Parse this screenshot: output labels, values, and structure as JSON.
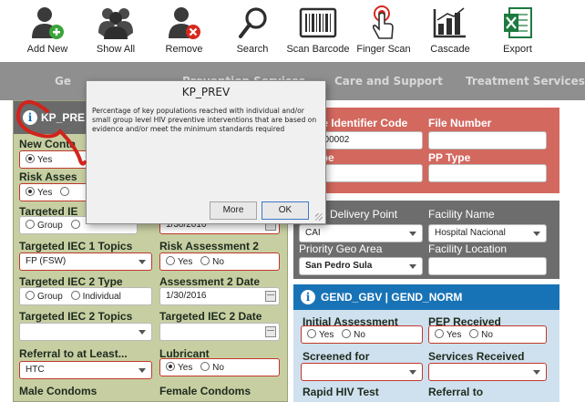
{
  "toolbar": {
    "add_new": "Add New",
    "show_all": "Show All",
    "remove": "Remove",
    "search": "Search",
    "scan_barcode": "Scan Barcode",
    "finger_scan": "Finger Scan",
    "cascade": "Cascade",
    "export": "Export"
  },
  "nav": {
    "tab1": "Ge",
    "tab1b": "l",
    "tab2": "Prevention Services",
    "tab3": "Care and Support",
    "tab4": "Treatment Services"
  },
  "left": {
    "header": "KP_PRE",
    "new_contact": "New Conta",
    "yes": "Yes",
    "risk_assess": "Risk Asses",
    "targeted_ie": "Targeted IE",
    "group": "Group",
    "date_partial": "1/30/2016",
    "iec1_topics": "Targeted IEC 1 Topics",
    "iec1_value": "FP (FSW)",
    "risk_assessment_2": "Risk Assessment 2",
    "no": "No",
    "iec2_type": "Targeted IEC 2 Type",
    "individual": "Individual",
    "assessment2_date": "Assessment 2 Date",
    "assessment2_value": "1/30/2016",
    "iec2_topics": "Targeted IEC 2 Topics",
    "iec2_date": "Targeted IEC 2 Date",
    "referral": "Referral to at Least...",
    "referral_value": "HTC",
    "lubricant": "Lubricant",
    "male_condoms": "Male Condoms",
    "female_condoms": "Female Condoms"
  },
  "red": {
    "uic": "ue Identifier Code",
    "uic_value": "z-1--00002",
    "type": "ype",
    "file_number": "File Number",
    "pp_type": "PP Type"
  },
  "gray": {
    "sdp": "ce Delivery Point",
    "sdp_value": "CAI",
    "facility_name": "Facility Name",
    "facility_value": "Hospital Nacional",
    "priority_geo": "Priority Geo Area",
    "priority_value": "San Pedro Sula",
    "facility_location": "Facility Location"
  },
  "blue": {
    "header": "GEND_GBV | GEND_NORM",
    "initial_assessment": "Initial Assessment",
    "pep_received": "PEP Received",
    "yes": "Yes",
    "no": "No",
    "screened_for": "Screened for",
    "services_received": "Services Received",
    "rapid_hiv": "Rapid HIV Test",
    "referral_to": "Referral to"
  },
  "modal": {
    "title": "KP_PREV",
    "body": "Percentage of key populations reached with individual and/or small group level HIV preventive interventions that are based on evidence and/or meet the minimum standards required",
    "more": "More",
    "ok": "OK"
  },
  "colors": {
    "olive_panel": "#c7cfa2",
    "red_panel": "#d3685f",
    "gray_panel": "#6d6d6d",
    "blue_panel": "#cfe1ee",
    "blue_header": "#1873b6",
    "annotation": "#d0241c"
  }
}
